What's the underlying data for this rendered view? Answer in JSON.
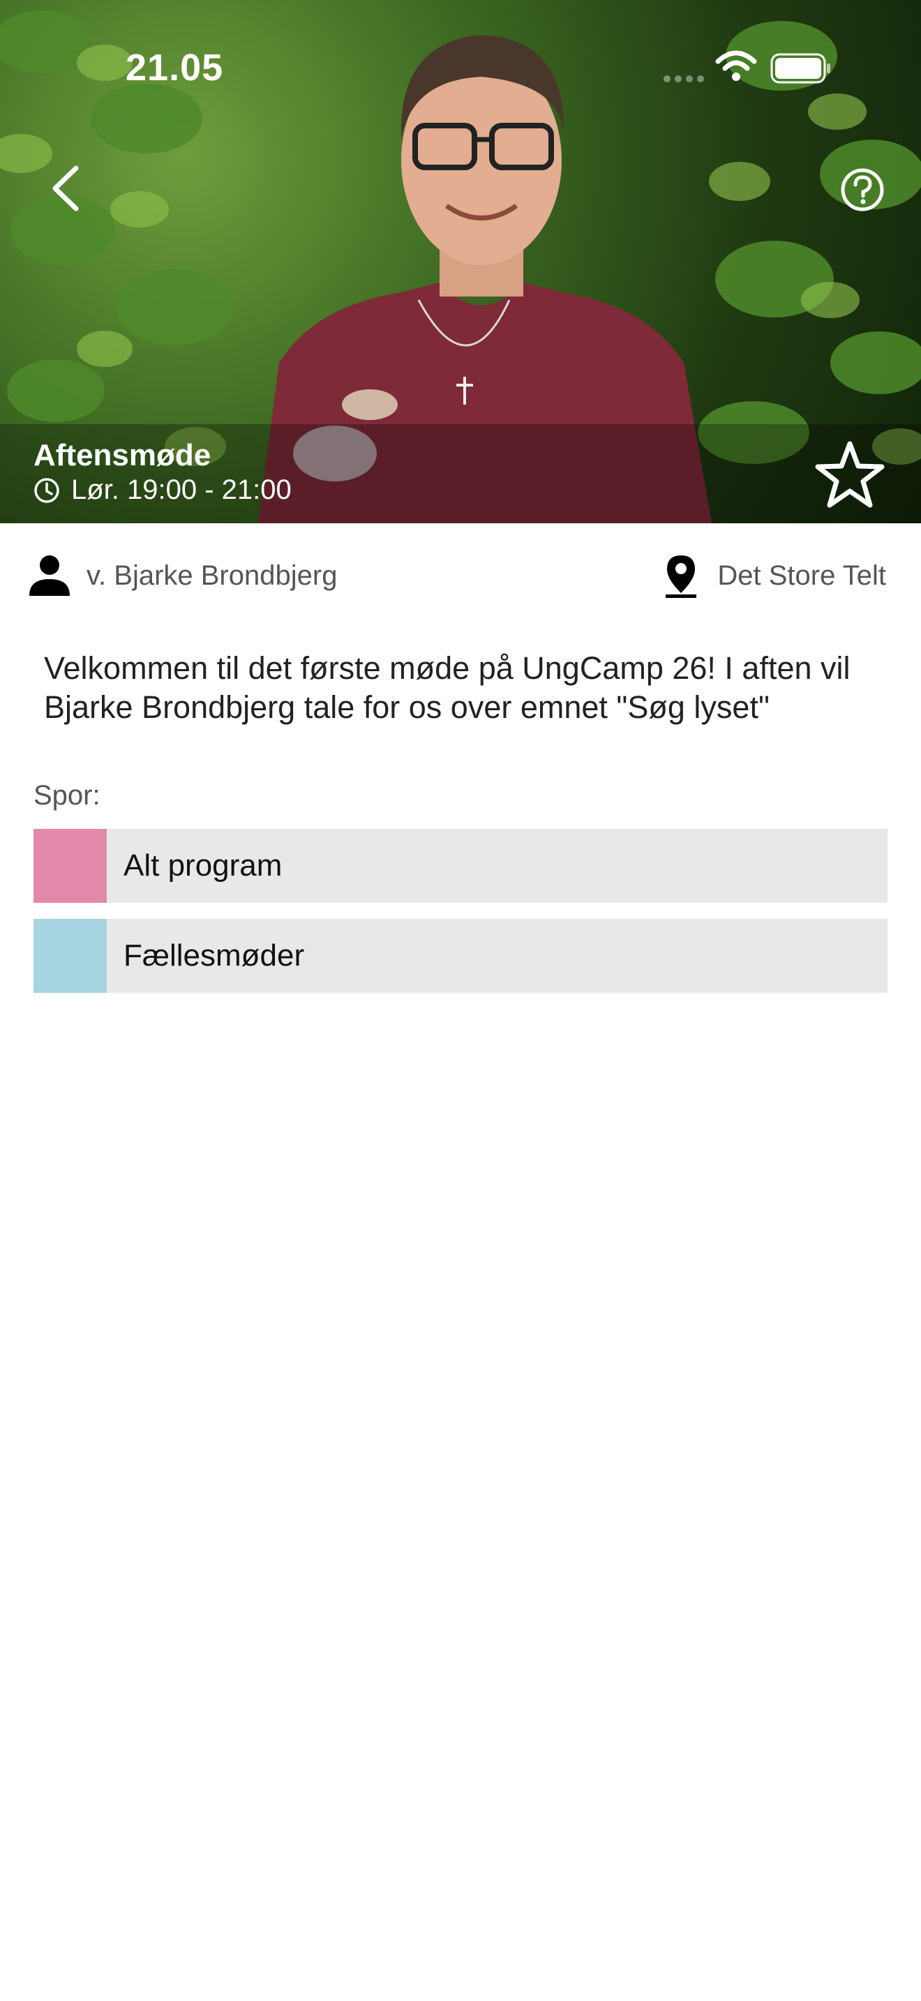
{
  "status_bar": {
    "time": "21.05"
  },
  "event": {
    "title": "Aftensmøde",
    "time": "Lør. 19:00 - 21:00",
    "speaker": "v. Bjarke Brondbjerg",
    "location": "Det Store Telt",
    "description": "Velkommen til det første møde på UngCamp 26! I aften vil Bjarke Brondbjerg tale for os over emnet \"Søg lyset\""
  },
  "tracks": {
    "label": "Spor:",
    "items": [
      {
        "label": "Alt program",
        "color": "#e38aac"
      },
      {
        "label": "Fællesmøder",
        "color": "#a6d4e0"
      }
    ]
  },
  "icons": {
    "back": "chevron-left-icon",
    "help": "help-circle-icon",
    "favorite": "star-outline-icon",
    "clock": "clock-icon",
    "person": "person-icon",
    "location": "location-pin-icon"
  },
  "colors": {
    "track_background": "#e8e8e8",
    "header_overlay": "rgba(0,0,0,0.28)"
  }
}
